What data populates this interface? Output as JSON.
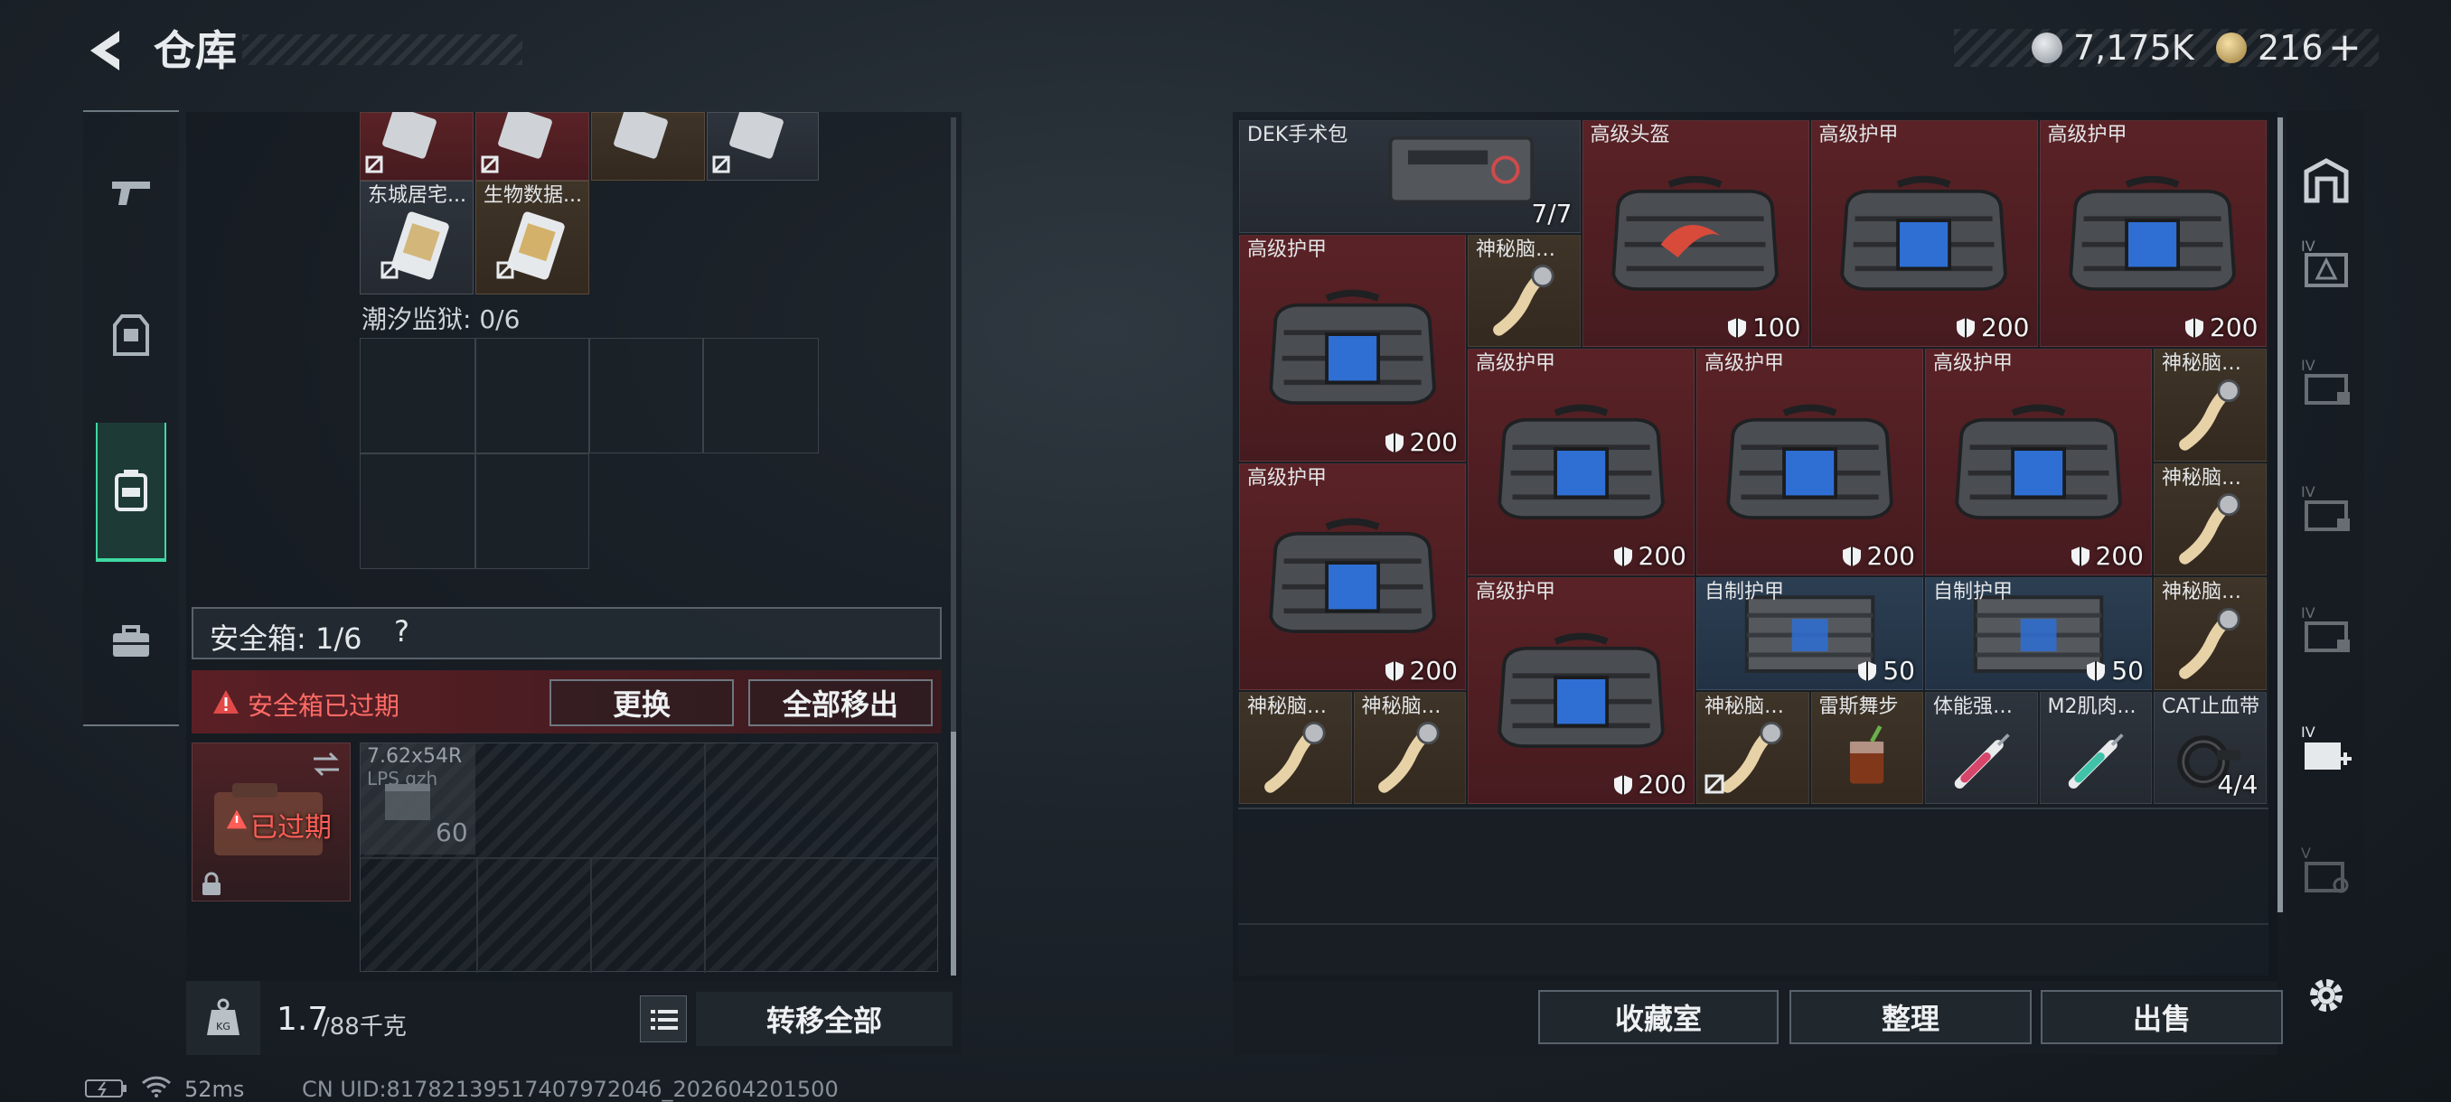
{
  "header": {
    "title": "仓库",
    "silver": "7,175K",
    "gold": "216",
    "plus": "+"
  },
  "left": {
    "keycard_row1": [
      {
        "name": ""
      },
      {
        "name": ""
      },
      {
        "name": ""
      },
      {
        "name": ""
      }
    ],
    "keycards": [
      {
        "name": "东城居宅..."
      },
      {
        "name": "生物数据..."
      }
    ],
    "prison_label": "潮汐监狱: 0/6",
    "safebox_label": "安全箱: 1/6",
    "safebox_help": "?",
    "expired_warning": "安全箱已过期",
    "replace_button": "更换",
    "move_all_button": "全部移出",
    "expired_badge": "已过期",
    "ammo": {
      "name": "7.62x54R",
      "sub": "LPS gzh",
      "qty": "60"
    },
    "weight": {
      "current": "1.7",
      "max": "/88千克"
    },
    "transfer_all": "转移全部"
  },
  "stash": {
    "items": [
      {
        "name": "DEK手术包",
        "qty": "7/7"
      },
      {
        "name": "高级头盔",
        "value": "100"
      },
      {
        "name": "高级护甲",
        "value": "200"
      },
      {
        "name": "高级护甲",
        "value": "200"
      },
      {
        "name": "高级护甲",
        "value": "200"
      },
      {
        "name": "神秘脑机..."
      },
      {
        "name": "高级护甲",
        "value": "200"
      },
      {
        "name": "高级护甲",
        "value": "200"
      },
      {
        "name": "高级护甲",
        "value": "200"
      },
      {
        "name": "神秘脑机..."
      },
      {
        "name": "高级护甲",
        "value": "200"
      },
      {
        "name": "神秘脑机..."
      },
      {
        "name": "高级护甲",
        "value": "200"
      },
      {
        "name": "自制护甲",
        "value": "50"
      },
      {
        "name": "自制护甲",
        "value": "50"
      },
      {
        "name": "神秘脑机..."
      },
      {
        "name": "神秘脑机..."
      },
      {
        "name": "神秘脑机..."
      },
      {
        "name": "神秘脑机..."
      },
      {
        "name": "雷斯舞步"
      },
      {
        "name": "体能强化剂"
      },
      {
        "name": "M2肌肉..."
      },
      {
        "name": "CAT止血带",
        "qty": "4/4"
      }
    ],
    "buttons": {
      "collection": "收藏室",
      "sort": "整理",
      "sell": "出售"
    }
  },
  "status": {
    "ping": "52ms",
    "uid": "CN UID:8178213951740797204б_202604201500"
  },
  "colors": {
    "red_item": "#4f1f23",
    "blue_item": "#27394c",
    "accent_green": "#3fd8a0",
    "warning": "#e24a48"
  }
}
